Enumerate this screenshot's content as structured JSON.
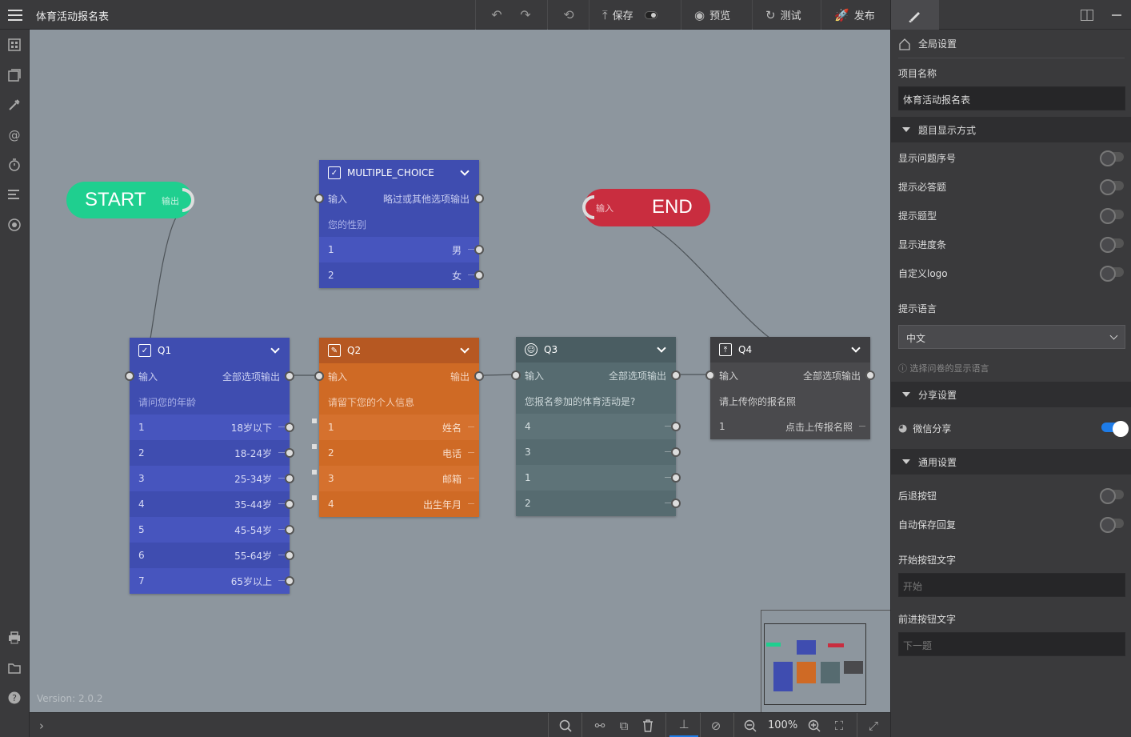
{
  "app": {
    "title": "体育活动报名表",
    "version": "Version: 2.0.2"
  },
  "toolbar": {
    "save": "保存",
    "preview": "预览",
    "test": "测试",
    "publish": "发布"
  },
  "canvas": {
    "start": {
      "label": "START",
      "out": "输出"
    },
    "end": {
      "label": "END",
      "in": "输入"
    },
    "nodes": {
      "mc": {
        "title": "MULTIPLE_CHOICE",
        "in": "输入",
        "out": "略过或其他选项输出",
        "question": "您的性别",
        "options": [
          {
            "n": "1",
            "t": "男"
          },
          {
            "n": "2",
            "t": "女"
          }
        ]
      },
      "q1": {
        "title": "Q1",
        "in": "输入",
        "out": "全部选项输出",
        "question": "请问您的年龄",
        "options": [
          {
            "n": "1",
            "t": "18岁以下"
          },
          {
            "n": "2",
            "t": "18-24岁"
          },
          {
            "n": "3",
            "t": "25-34岁"
          },
          {
            "n": "4",
            "t": "35-44岁"
          },
          {
            "n": "5",
            "t": "45-54岁"
          },
          {
            "n": "6",
            "t": "55-64岁"
          },
          {
            "n": "7",
            "t": "65岁以上"
          }
        ]
      },
      "q2": {
        "title": "Q2",
        "in": "输入",
        "out": "输出",
        "question": "请留下您的个人信息",
        "options": [
          {
            "n": "1",
            "t": "姓名"
          },
          {
            "n": "2",
            "t": "电话"
          },
          {
            "n": "3",
            "t": "邮箱"
          },
          {
            "n": "4",
            "t": "出生年月"
          }
        ]
      },
      "q3": {
        "title": "Q3",
        "in": "输入",
        "out": "全部选项输出",
        "question": "您报名参加的体育活动是?",
        "options": [
          {
            "n": "4",
            "t": ""
          },
          {
            "n": "3",
            "t": ""
          },
          {
            "n": "1",
            "t": ""
          },
          {
            "n": "2",
            "t": ""
          }
        ]
      },
      "q4": {
        "title": "Q4",
        "in": "输入",
        "out": "全部选项输出",
        "question": "请上传你的报名照",
        "options": [
          {
            "n": "1",
            "t": "点击上传报名照"
          }
        ]
      }
    }
  },
  "zoom": "100%",
  "panel": {
    "global": "全局设置",
    "project_name_label": "项目名称",
    "project_name_value": "体育活动报名表",
    "sec_display": "题目显示方式",
    "toggles_display": [
      {
        "label": "显示问题序号",
        "on": false
      },
      {
        "label": "提示必答题",
        "on": false
      },
      {
        "label": "提示题型",
        "on": false
      },
      {
        "label": "显示进度条",
        "on": false
      },
      {
        "label": "自定义logo",
        "on": false
      }
    ],
    "lang_label": "提示语言",
    "lang_value": "中文",
    "lang_hint": "选择问卷的显示语言",
    "sec_share": "分享设置",
    "wechat": "微信分享",
    "sec_general": "通用设置",
    "back_btn": "后退按钮",
    "autosave": "自动保存回复",
    "start_text_label": "开始按钮文字",
    "start_text_ph": "开始",
    "next_text_label": "前进按钮文字",
    "next_text_ph": "下一题"
  }
}
